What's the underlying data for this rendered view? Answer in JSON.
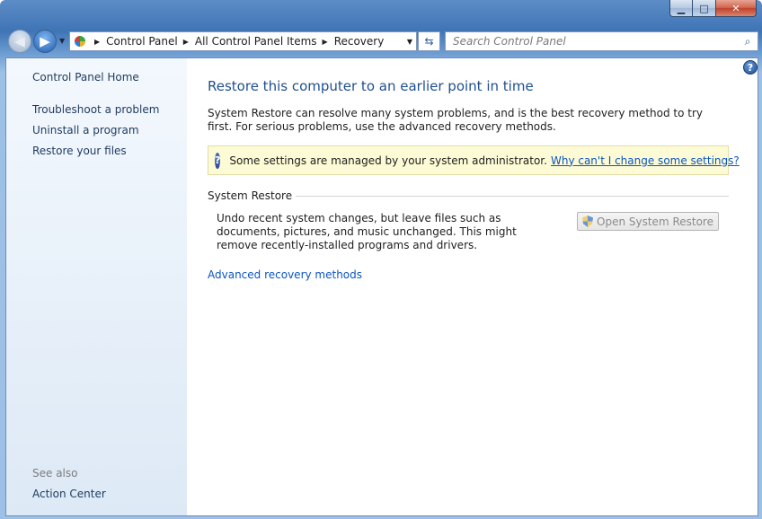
{
  "window": {
    "caption_buttons": {
      "minimize": "▁",
      "maximize": "□",
      "close": "✕"
    }
  },
  "navbar": {
    "breadcrumbs": [
      "Control Panel",
      "All Control Panel Items",
      "Recovery"
    ],
    "search_placeholder": "Search Control Panel"
  },
  "sidebar": {
    "home": "Control Panel Home",
    "links": [
      "Troubleshoot a problem",
      "Uninstall a program",
      "Restore your files"
    ],
    "see_also_label": "See also",
    "see_also_links": [
      "Action Center"
    ]
  },
  "main": {
    "title": "Restore this computer to an earlier point in time",
    "description": "System Restore can resolve many system problems, and is the best recovery method to try first. For serious problems, use the advanced recovery methods.",
    "info": {
      "text": "Some settings are managed by your system administrator.",
      "link": "Why can't I change some settings?"
    },
    "system_restore": {
      "heading": "System Restore",
      "description": "Undo recent system changes, but leave files such as documents, pictures, and music unchanged. This might remove recently-installed programs and drivers.",
      "button": "Open System Restore"
    },
    "advanced_link": "Advanced recovery methods"
  },
  "icons": {
    "back": "arrow-left-icon",
    "forward": "arrow-right-icon",
    "control_panel": "control-panel-icon",
    "refresh": "refresh-icon",
    "search": "search-icon",
    "help": "help-icon",
    "info": "info-icon",
    "shield": "shield-icon"
  }
}
